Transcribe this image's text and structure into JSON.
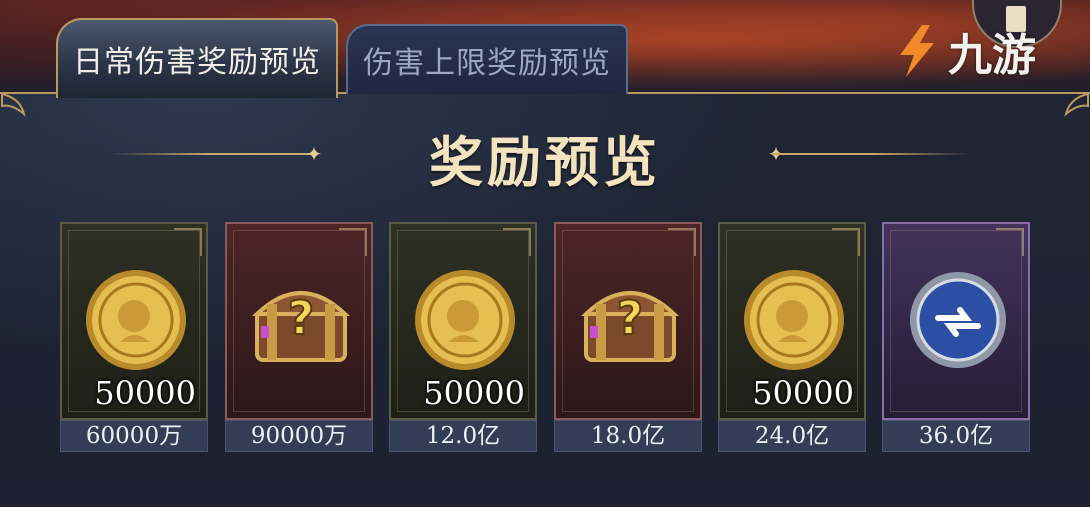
{
  "tabs": [
    {
      "label": "日常伤害奖励预览",
      "active": true
    },
    {
      "label": "伤害上限奖励预览",
      "active": false
    }
  ],
  "watermark": {
    "text": "九游"
  },
  "title": "奖励预览",
  "rewards": [
    {
      "item": "gold-coin-icon",
      "quantity": "50000",
      "threshold": "60000万",
      "frame": "gold"
    },
    {
      "item": "mystery-chest-icon",
      "quantity": "",
      "threshold": "90000万",
      "frame": "red"
    },
    {
      "item": "gold-coin-icon",
      "quantity": "50000",
      "threshold": "12.0亿",
      "frame": "gold"
    },
    {
      "item": "mystery-chest-icon",
      "quantity": "",
      "threshold": "18.0亿",
      "frame": "red"
    },
    {
      "item": "gold-coin-icon",
      "quantity": "50000",
      "threshold": "24.0亿",
      "frame": "gold"
    },
    {
      "item": "blue-emblem-icon",
      "quantity": "",
      "threshold": "36.0亿",
      "frame": "purple"
    }
  ],
  "colors": {
    "accent_gold": "#c9a86a",
    "title_text": "#f3e4bf",
    "panel_bg": "#1b2130"
  }
}
